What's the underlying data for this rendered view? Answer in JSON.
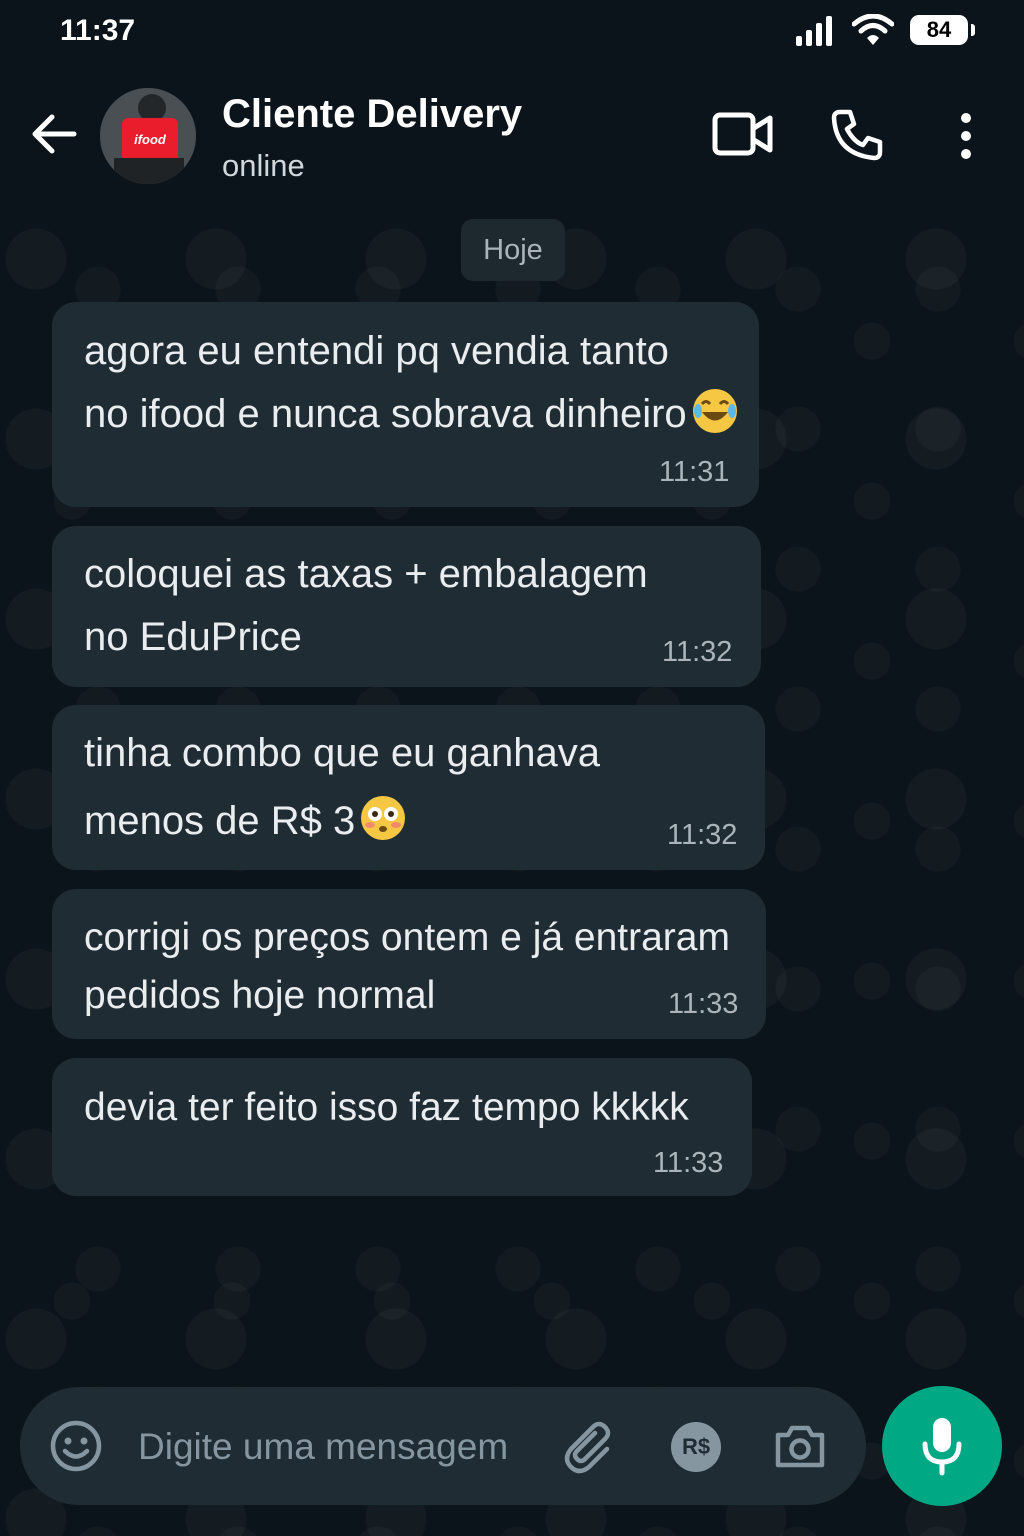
{
  "status_bar": {
    "time": "11:37",
    "battery": "84"
  },
  "header": {
    "contact_name": "Cliente Delivery",
    "contact_status": "online",
    "avatar_badge": "ifood"
  },
  "date_divider": "Hoje",
  "messages": [
    {
      "lines": [
        "agora eu entendi pq vendia tanto",
        "no ifood e nunca sobrava dinheiro"
      ],
      "emoji": "tears-of-joy",
      "time": "11:31"
    },
    {
      "lines": [
        "coloquei as taxas + embalagem",
        "no EduPrice"
      ],
      "time": "11:32"
    },
    {
      "lines": [
        "tinha combo que eu ganhava",
        "menos de R$ 3"
      ],
      "emoji": "flushed",
      "time": "11:32"
    },
    {
      "lines": [
        "corrigi os preços ontem e já entraram",
        "pedidos hoje normal"
      ],
      "time": "11:33"
    },
    {
      "lines": [
        "devia ter feito isso faz tempo kkkkk"
      ],
      "time": "11:33"
    }
  ],
  "input": {
    "placeholder": "Digite uma mensagem",
    "value": "",
    "payment_label": "R$"
  },
  "colors": {
    "background": "#0b141a",
    "bubble": "#202c33",
    "accent": "#00a884"
  }
}
